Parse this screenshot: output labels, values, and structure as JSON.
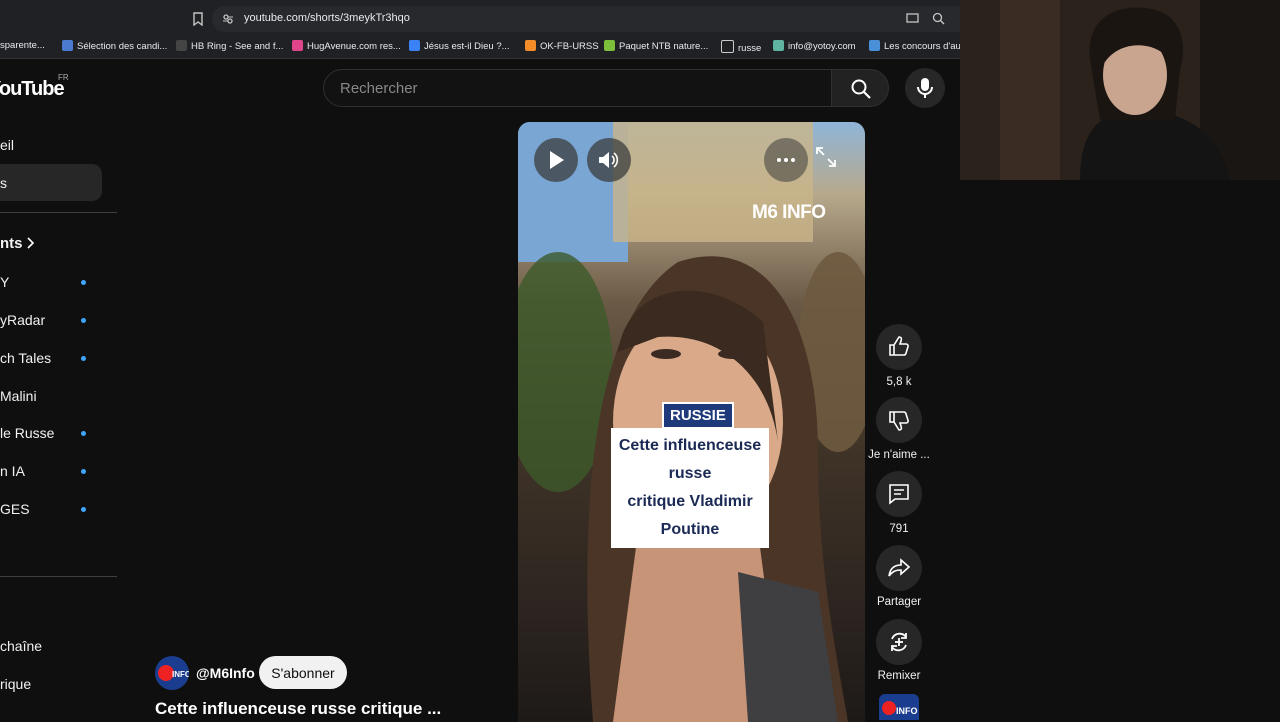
{
  "browser": {
    "url": "youtube.com/shorts/3meykTr3hqo",
    "bookmarks": [
      {
        "label": "sparente...",
        "color": "#888888"
      },
      {
        "label": "Sélection des candi...",
        "color": "#4a7bd0"
      },
      {
        "label": "HB Ring - See and f...",
        "color": "#444444"
      },
      {
        "label": "HugAvenue.com res...",
        "color": "#e0458c"
      },
      {
        "label": "Jésus est-il Dieu ?...",
        "color": "#3b82f6"
      },
      {
        "label": "OK-FB-URSS",
        "color": "#f28c28"
      },
      {
        "label": "Paquet NTB nature...",
        "color": "#7cbf3a"
      },
      {
        "label": "russe",
        "color": "#cccccc"
      },
      {
        "label": "info@yotoy.com",
        "color": "#5fb3a1"
      },
      {
        "label": "Les concours d'auto",
        "color": "#4a90d9"
      }
    ]
  },
  "header": {
    "logo": "YouTube",
    "region": "FR",
    "search_placeholder": "Rechercher"
  },
  "sidebar": {
    "items": [
      {
        "label": "eil"
      },
      {
        "label": "s"
      },
      {
        "label": "nts"
      },
      {
        "label": "Y"
      },
      {
        "label": "yRadar"
      },
      {
        "label": "ch Tales"
      },
      {
        "label": "Malini"
      },
      {
        "label": "le Russe"
      },
      {
        "label": "n IA"
      },
      {
        "label": "GES"
      },
      {
        "label": "chaîne"
      },
      {
        "label": "rique"
      }
    ]
  },
  "video": {
    "channel_logo": "M6 INFO",
    "tag": "RUSSIE",
    "caption_line1": "Cette influenceuse russe",
    "caption_line2": "critique Vladimir Poutine"
  },
  "actions": {
    "likes": "5,8 k",
    "dislike_label": "Je n'aime ...",
    "comments": "791",
    "share_label": "Partager",
    "remix_label": "Remixer"
  },
  "channel": {
    "handle": "@M6Info",
    "subscribe_label": "S'abonner",
    "title": "Cette influenceuse russe critique ..."
  }
}
